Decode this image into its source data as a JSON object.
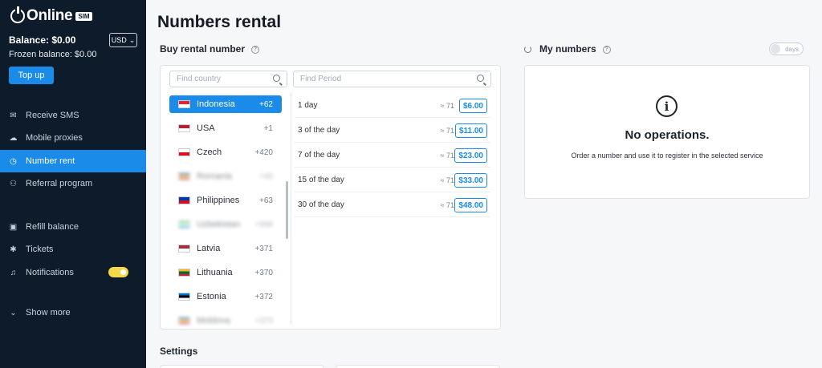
{
  "brand": {
    "name": "Online",
    "badge": "SIM"
  },
  "account": {
    "balance": "Balance: $0.00",
    "frozen": "Frozen balance: $0.00",
    "currency": "USD",
    "topup_label": "Top up"
  },
  "nav": {
    "items": [
      {
        "label": "Receive SMS",
        "icon": "envelope-icon"
      },
      {
        "label": "Mobile proxies",
        "icon": "cloud-icon"
      },
      {
        "label": "Number rent",
        "icon": "clock-icon",
        "active": true
      },
      {
        "label": "Referral program",
        "icon": "users-icon"
      },
      {
        "label": "Refill balance",
        "icon": "wallet-icon"
      },
      {
        "label": "Tickets",
        "icon": "bug-icon"
      },
      {
        "label": "Notifications",
        "icon": "bell-icon"
      },
      {
        "label": "Show more",
        "icon": "chevron-down-icon"
      }
    ]
  },
  "page": {
    "title": "Numbers rental",
    "buy_title": "Buy rental number",
    "my_numbers_title": "My numbers",
    "settings_title": "Settings"
  },
  "search": {
    "country_placeholder": "Find country",
    "period_placeholder": "Find Period"
  },
  "countries": [
    {
      "name": "Indonesia",
      "code": "+62",
      "active": true,
      "colors": [
        "#e2262e",
        "#ffffff"
      ]
    },
    {
      "name": "USA",
      "code": "+1",
      "colors": [
        "#b22234",
        "#ffffff"
      ]
    },
    {
      "name": "Czech",
      "code": "+420",
      "colors": [
        "#ffffff",
        "#d7141a"
      ]
    },
    {
      "name": "Romania",
      "code": "+40",
      "blurred": true,
      "colors": [
        "#002b7f",
        "#fcd116",
        "#ce1126"
      ]
    },
    {
      "name": "Philippines",
      "code": "+63",
      "colors": [
        "#0038a8",
        "#ce1126"
      ]
    },
    {
      "name": "Uzbekistan",
      "code": "+998",
      "blurred": true,
      "colors": [
        "#1eb53a",
        "#ffffff",
        "#0099b5"
      ]
    },
    {
      "name": "Latvia",
      "code": "+371",
      "colors": [
        "#9e3039",
        "#ffffff"
      ]
    },
    {
      "name": "Lithuania",
      "code": "+370",
      "colors": [
        "#fdb913",
        "#006a44",
        "#c1272d"
      ]
    },
    {
      "name": "Estonia",
      "code": "+372",
      "colors": [
        "#0072ce",
        "#000000",
        "#ffffff"
      ]
    },
    {
      "name": "Moldova",
      "code": "+373",
      "blurred": true,
      "colors": [
        "#0046ae",
        "#ffd200",
        "#cc092f"
      ]
    }
  ],
  "periods": [
    {
      "label": "1 day",
      "qty": "≈ 71",
      "price": "$6.00"
    },
    {
      "label": "3 of the day",
      "qty": "≈ 71",
      "price": "$11.00"
    },
    {
      "label": "7 of the day",
      "qty": "≈ 71",
      "price": "$23.00"
    },
    {
      "label": "15 of the day",
      "qty": "≈ 71",
      "price": "$33.00"
    },
    {
      "label": "30 of the day",
      "qty": "≈ 71",
      "price": "$48.00"
    }
  ],
  "my_numbers": {
    "toggle_label": "days",
    "empty_title": "No operations.",
    "empty_sub": "Order a number and use it to register in the selected service"
  },
  "colors": {
    "accent": "#1a8be8",
    "sidebar": "#0e1b2b",
    "notif_toggle": "#f5d84a"
  }
}
